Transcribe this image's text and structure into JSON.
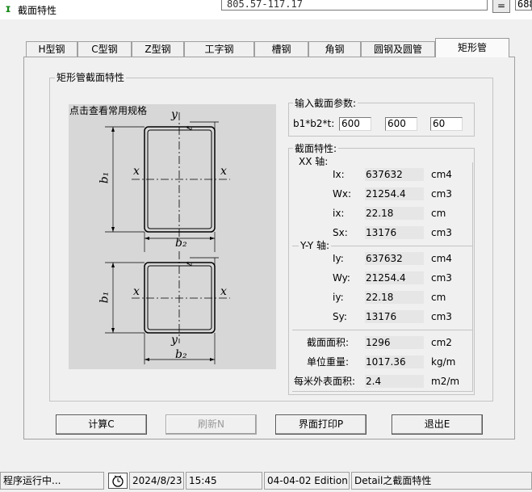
{
  "window": {
    "title": "截面特性",
    "app_icon": "ɪ"
  },
  "calculator": {
    "expression": "805.57-117.17",
    "equals_label": "=",
    "result": "688"
  },
  "tabs": [
    {
      "label": "H型钢"
    },
    {
      "label": "C型钢"
    },
    {
      "label": "Z型钢"
    },
    {
      "label": "工字钢"
    },
    {
      "label": "槽钢"
    },
    {
      "label": "角钢"
    },
    {
      "label": "圆钢及圆管"
    },
    {
      "label": "矩形管"
    }
  ],
  "panel": {
    "group_title": "矩形管截面特性",
    "diagram_title": "点击查看常用规格"
  },
  "diagram": {
    "y_label": "y",
    "x_label": "x",
    "t_label": "t",
    "b1_label": "b₁",
    "b2_label": "b₂"
  },
  "input_group": {
    "title": "输入截面参数:",
    "params_label": "b1*b2*t:",
    "b1": "600",
    "b2": "600",
    "t": "60"
  },
  "props": {
    "title": "截面特性:",
    "xx_title": "XX 轴:",
    "yy_title": "Y-Y 轴:",
    "xx": [
      {
        "label": "Ix:",
        "value": "637632",
        "unit": "cm4"
      },
      {
        "label": "Wx:",
        "value": "21254.4",
        "unit": "cm3"
      },
      {
        "label": "ix:",
        "value": "22.18",
        "unit": "cm"
      },
      {
        "label": "Sx:",
        "value": "13176",
        "unit": "cm3"
      }
    ],
    "yy": [
      {
        "label": "Iy:",
        "value": "637632",
        "unit": "cm4"
      },
      {
        "label": "Wy:",
        "value": "21254.4",
        "unit": "cm3"
      },
      {
        "label": "iy:",
        "value": "22.18",
        "unit": "cm"
      },
      {
        "label": "Sy:",
        "value": "13176",
        "unit": "cm3"
      }
    ],
    "general": [
      {
        "label": "截面面积:",
        "value": "1296",
        "unit": "cm2"
      },
      {
        "label": "单位重量:",
        "value": "1017.36",
        "unit": "kg/m"
      },
      {
        "label": "每米外表面积:",
        "value": "2.4",
        "unit": "m2/m"
      }
    ]
  },
  "buttons": {
    "calc": "计算C",
    "refresh": "刷新N",
    "print": "界面打印P",
    "exit": "退出E"
  },
  "statusbar": {
    "status": "程序运行中...",
    "date": "2024/8/23",
    "time": "15:45",
    "edition": "04-04-02 Edition",
    "module": "Detail之截面特性"
  }
}
